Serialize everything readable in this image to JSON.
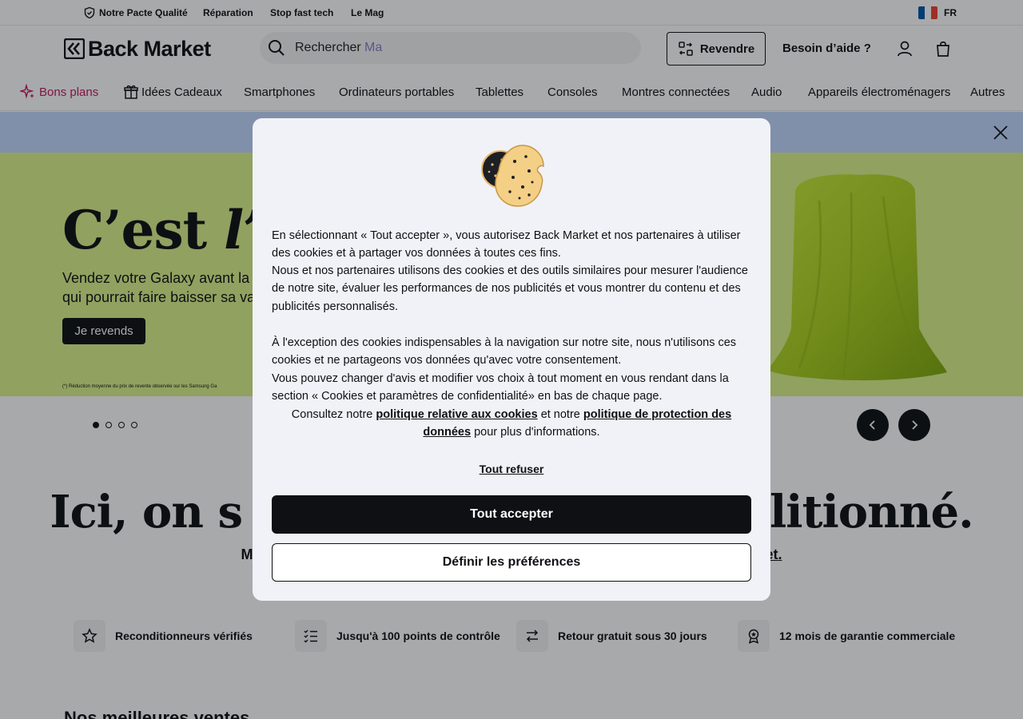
{
  "topbar": {
    "links": [
      "Notre Pacte Qualité",
      "Réparation",
      "Stop fast tech",
      "Le Mag"
    ],
    "language": "FR"
  },
  "header": {
    "logo": "Back Market",
    "search_placeholder": "Rechercher",
    "search_hint": "Ma",
    "sell_button": "Revendre",
    "help_link": "Besoin d’aide ?"
  },
  "nav": {
    "items": [
      "Bons plans",
      "Idées Cadeaux",
      "Smartphones",
      "Ordinateurs portables",
      "Tablettes",
      "Consoles",
      "Montres connectées",
      "Audio",
      "Appareils électroménagers",
      "Autres"
    ]
  },
  "hero": {
    "title_start": "C’est ",
    "title_italic": "l’or",
    "subtitle_line1": "Vendez votre Galaxy avant la",
    "subtitle_line2": "qui pourrait faire baisser sa va",
    "cta": "Je revends",
    "footnote": "(*) Réduction moyenne du prix de revente observée sur les Samsung Ga",
    "slides_total": 4,
    "slide_active": 1
  },
  "headline": {
    "left": "Ici, on s",
    "right": "litionné.",
    "sub_left": "Mo",
    "sub_right": "ket."
  },
  "guarantees": [
    {
      "icon": "star-icon",
      "label": "Reconditionneurs vérifiés"
    },
    {
      "icon": "checklist-icon",
      "label": "Jusqu'à 100 points de contrôle"
    },
    {
      "icon": "swap-icon",
      "label": "Retour gratuit sous 30 jours"
    },
    {
      "icon": "award-icon",
      "label": "12 mois de garantie commerciale"
    }
  ],
  "section_title": "Nos meilleures ventes",
  "cookie_modal": {
    "p1": "En sélectionnant « Tout accepter », vous autorisez Back Market et nos partenaires à utiliser des cookies et à partager vos données à toutes ces fins.",
    "p2": "Nous et nos partenaires utilisons des cookies et des outils similaires pour mesurer l'audience de notre site, évaluer les performances de nos publicités et vous montrer du contenu et des publicités personnalisés.",
    "p3": "À l'exception des cookies indispensables à la navigation sur notre site, nous n'utilisons ces cookies et ne partageons vos données qu'avec votre consentement.",
    "p4": "Vous pouvez changer d'avis et modifier vos choix à tout moment en vous rendant dans la section « Cookies et paramètres de confidentialité» en bas de chaque page.",
    "consult_prefix": "Consultez notre",
    "cookie_policy_link": "politique relative aux cookies",
    "and": "et notre",
    "privacy_link": "politique de protection des données",
    "consult_suffix": "pour plus d'informations.",
    "refuse": "Tout refuser",
    "accept": "Tout accepter",
    "preferences": "Définir les préférences"
  },
  "colors": {
    "hero_bg": "#dcf28c",
    "info_banner": "#c2d8ff",
    "deal_accent": "#c2185b",
    "primary": "#0e1014"
  }
}
